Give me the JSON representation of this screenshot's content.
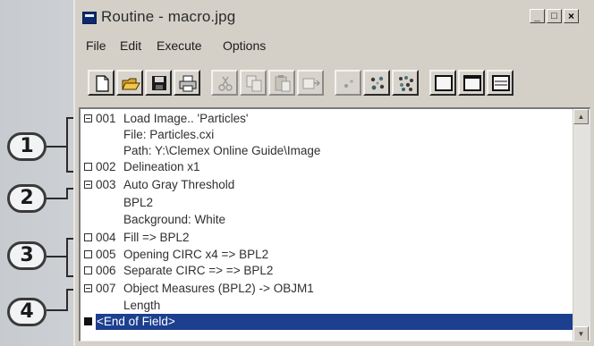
{
  "window": {
    "title": "Routine - macro.jpg",
    "controls": {
      "minimize": "_",
      "maximize": "□",
      "close": "×"
    }
  },
  "menu": [
    "File",
    "Edit",
    "Execute",
    "Options"
  ],
  "toolbar": {
    "buttons": [
      {
        "icon": "new-document-icon",
        "enabled": true
      },
      {
        "icon": "open-folder-icon",
        "enabled": true
      },
      {
        "icon": "save-disk-icon",
        "enabled": true
      },
      {
        "icon": "print-icon",
        "enabled": true
      },
      {
        "icon": "cut-icon",
        "enabled": false
      },
      {
        "icon": "copy-icon",
        "enabled": false
      },
      {
        "icon": "paste-icon",
        "enabled": false
      },
      {
        "icon": "insert-icon",
        "enabled": false
      },
      {
        "icon": "step-icon",
        "enabled": false
      },
      {
        "icon": "run-icon",
        "enabled": true
      },
      {
        "icon": "run-all-icon",
        "enabled": true
      },
      {
        "icon": "single-pane-icon",
        "enabled": true
      },
      {
        "icon": "split-pane-icon",
        "enabled": true
      },
      {
        "icon": "list-pane-icon",
        "enabled": true
      }
    ]
  },
  "routine": {
    "lines": [
      {
        "marker": "minus",
        "num": "001",
        "text": "Load Image.. 'Particles'"
      },
      {
        "marker": "",
        "num": "",
        "text": "File: Particles.cxi"
      },
      {
        "marker": "",
        "num": "",
        "text": "Path: Y:\\Clemex Online Guide\\Image"
      },
      {
        "marker": "box",
        "num": "002",
        "text": "Delineation x1"
      },
      {
        "marker": "minus",
        "num": "003",
        "text": "Auto Gray Threshold"
      },
      {
        "marker": "",
        "num": "",
        "text": "BPL2"
      },
      {
        "marker": "",
        "num": "",
        "text": "Background: White"
      },
      {
        "marker": "box",
        "num": "004",
        "text": "Fill => BPL2"
      },
      {
        "marker": "box",
        "num": "005",
        "text": "Opening CIRC x4 => BPL2"
      },
      {
        "marker": "box",
        "num": "006",
        "text": "Separate CIRC => => BPL2"
      },
      {
        "marker": "minus",
        "num": "007",
        "text": "Object Measures (BPL2) -> OBJM1"
      },
      {
        "marker": "",
        "num": "",
        "text": "Length"
      },
      {
        "marker": "filled",
        "num": "",
        "text": "<End of Field>",
        "selected": true
      }
    ],
    "end_label": "<End of Field>"
  },
  "callouts": [
    "1",
    "2",
    "3",
    "4"
  ],
  "colors": {
    "selection": "#1c3f8f",
    "window_face": "#d4d0c8",
    "callout_border": "#3a3a3a"
  }
}
